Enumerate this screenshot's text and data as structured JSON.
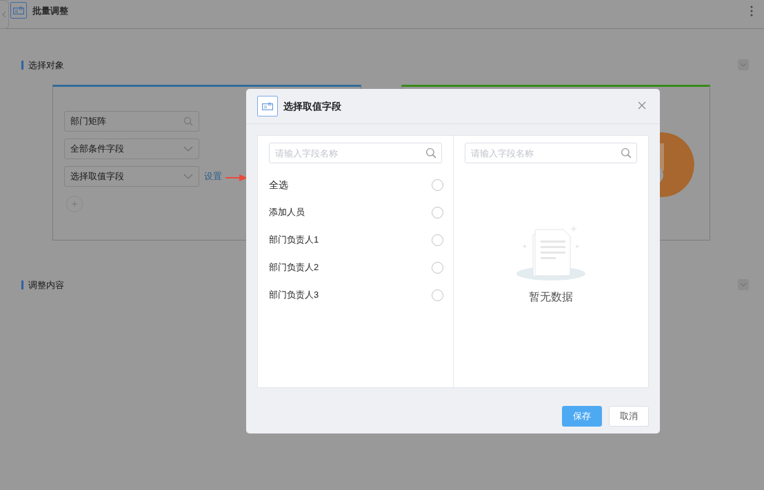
{
  "header": {
    "title": "批量调整"
  },
  "select_object": {
    "title": "选择对象",
    "fields": [
      {
        "kind": "search",
        "value": "部门矩阵"
      },
      {
        "kind": "select",
        "value": "全部条件字段"
      },
      {
        "kind": "select",
        "value": "选择取值字段"
      }
    ],
    "link": "设置"
  },
  "adjust_content": {
    "title": "调整内容"
  },
  "dialog": {
    "title": "选择取值字段",
    "left_panel": {
      "search": {
        "placeholder": "请输入字段名称"
      },
      "items": [
        {
          "label": "全选",
          "kind": "all",
          "selected": false
        },
        {
          "label": "添加人员",
          "kind": "field",
          "selected": false
        },
        {
          "label": "部门负责人1",
          "kind": "field",
          "selected": false
        },
        {
          "label": "部门负责人2",
          "kind": "field",
          "selected": false
        },
        {
          "label": "部门负责人3",
          "kind": "field",
          "selected": false
        }
      ]
    },
    "right_panel": {
      "search": {
        "placeholder": "请输入字段名称"
      },
      "empty_text": "暂无数据"
    },
    "buttons": [
      {
        "label": "保存",
        "kind": "primary"
      },
      {
        "label": "取消",
        "kind": "secondary"
      }
    ]
  }
}
